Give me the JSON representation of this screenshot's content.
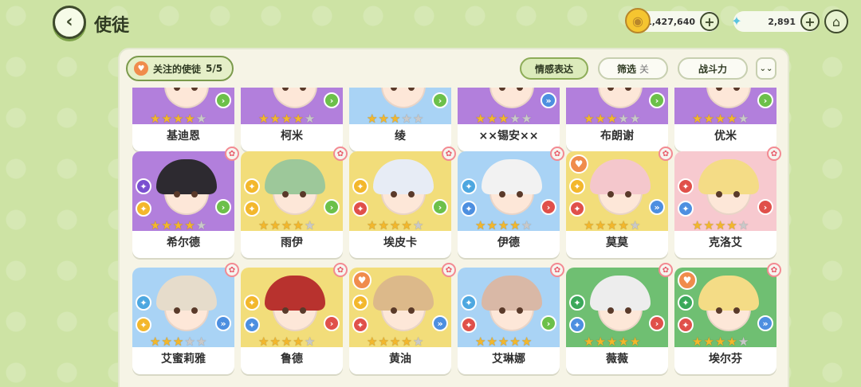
{
  "header": {
    "back_icon": "‹",
    "title": "使徒",
    "home_icon": "⌂"
  },
  "resources": [
    {
      "name": "gold",
      "value": "1,427,640",
      "icon": "coin-icon"
    },
    {
      "name": "crystal",
      "value": "2,891",
      "icon": "butterfly-icon"
    }
  ],
  "toolbar": {
    "follow_label": "关注的使徒",
    "follow_count": "5/5",
    "emotion_label": "情感表达",
    "filter_label": "筛选",
    "filter_state": "关",
    "power_label": "战斗力",
    "collapse_icon": "⌄⌄"
  },
  "characters": [
    {
      "name": "基迪恩",
      "stars": 4,
      "bg": "#b27fdc",
      "hair": "#4a3a3a",
      "badges": [
        "#e0504a"
      ],
      "arrow": "green",
      "fav": false
    },
    {
      "name": "柯米",
      "stars": 4,
      "bg": "#b27fdc",
      "hair": "#e9d4b8",
      "badges": [
        "#4d8fe0"
      ],
      "arrow": "green",
      "fav": false
    },
    {
      "name": "绫",
      "stars": 3,
      "bg": "#a9d3f5",
      "hair": "#e9e2dc",
      "badges": [
        "#e0504a"
      ],
      "arrow": "green",
      "fav": false
    },
    {
      "name": "××锡安××",
      "stars": 3,
      "bg": "#b27fdc",
      "hair": "#2e2a2e",
      "badges": [
        "#e0504a"
      ],
      "arrow": "blue",
      "fav": false
    },
    {
      "name": "布朗谢",
      "stars": 3,
      "bg": "#b27fdc",
      "hair": "#f0e0d0",
      "badges": [
        "#e0504a"
      ],
      "arrow": "green",
      "fav": false
    },
    {
      "name": "优米",
      "stars": 4,
      "bg": "#b27fdc",
      "hair": "#f3efe6",
      "badges": [
        "#f3b72c"
      ],
      "arrow": "green",
      "fav": false
    },
    {
      "name": "希尔德",
      "stars": 4,
      "bg": "#b27fdc",
      "hair": "#2d2a30",
      "badges": [
        "#7a4fd0",
        "#f3b72c"
      ],
      "arrow": "green",
      "fav": false
    },
    {
      "name": "雨伊",
      "stars": 4,
      "bg": "#f2dd7a",
      "hair": "#9dc89a",
      "badges": [
        "#f3b72c",
        "#f3b72c"
      ],
      "arrow": "green",
      "fav": false
    },
    {
      "name": "埃皮卡",
      "stars": 4,
      "bg": "#f2dd7a",
      "hair": "#e7ecf5",
      "badges": [
        "#f3b72c",
        "#e0504a"
      ],
      "arrow": "green",
      "fav": false
    },
    {
      "name": "伊德",
      "stars": 4,
      "bg": "#a9d3f5",
      "hair": "#f2f2f2",
      "badges": [
        "#4da7e0",
        "#4d8fe0"
      ],
      "arrow": "red",
      "fav": false
    },
    {
      "name": "莫莫",
      "stars": 4,
      "bg": "#f2dd7a",
      "hair": "#f4c7cc",
      "badges": [
        "#f3b72c",
        "#e0504a"
      ],
      "arrow": "blue",
      "fav": true
    },
    {
      "name": "克洛艾",
      "stars": 4,
      "bg": "#f7c9cf",
      "hair": "#f4dc86",
      "badges": [
        "#e0504a",
        "#4d8fe0"
      ],
      "arrow": "red",
      "fav": false
    },
    {
      "name": "艾蜜莉雅",
      "stars": 3,
      "bg": "#a9d3f5",
      "hair": "#e6dccb",
      "badges": [
        "#4da7e0",
        "#f3b72c"
      ],
      "arrow": "blue",
      "fav": false
    },
    {
      "name": "鲁德",
      "stars": 4,
      "bg": "#f2dd7a",
      "hair": "#b8322e",
      "badges": [
        "#f3b72c",
        "#4d8fe0"
      ],
      "arrow": "red",
      "fav": false
    },
    {
      "name": "黄油",
      "stars": 4,
      "bg": "#f2dd7a",
      "hair": "#dcb98a",
      "badges": [
        "#f3b72c",
        "#e0504a"
      ],
      "arrow": "blue",
      "fav": true
    },
    {
      "name": "艾琳娜",
      "stars": 5,
      "bg": "#a9d3f5",
      "hair": "#d9b8a6",
      "badges": [
        "#4da7e0",
        "#e0504a"
      ],
      "arrow": "green",
      "fav": false
    },
    {
      "name": "薇薇",
      "stars": 5,
      "bg": "#6fbf72",
      "hair": "#ededed",
      "badges": [
        "#3aa85a",
        "#4d8fe0"
      ],
      "arrow": "red",
      "fav": false
    },
    {
      "name": "埃尔芬",
      "stars": 4,
      "bg": "#6fbf72",
      "hair": "#f4dc86",
      "badges": [
        "#3aa85a",
        "#e0504a"
      ],
      "arrow": "blue",
      "fav": true
    }
  ]
}
